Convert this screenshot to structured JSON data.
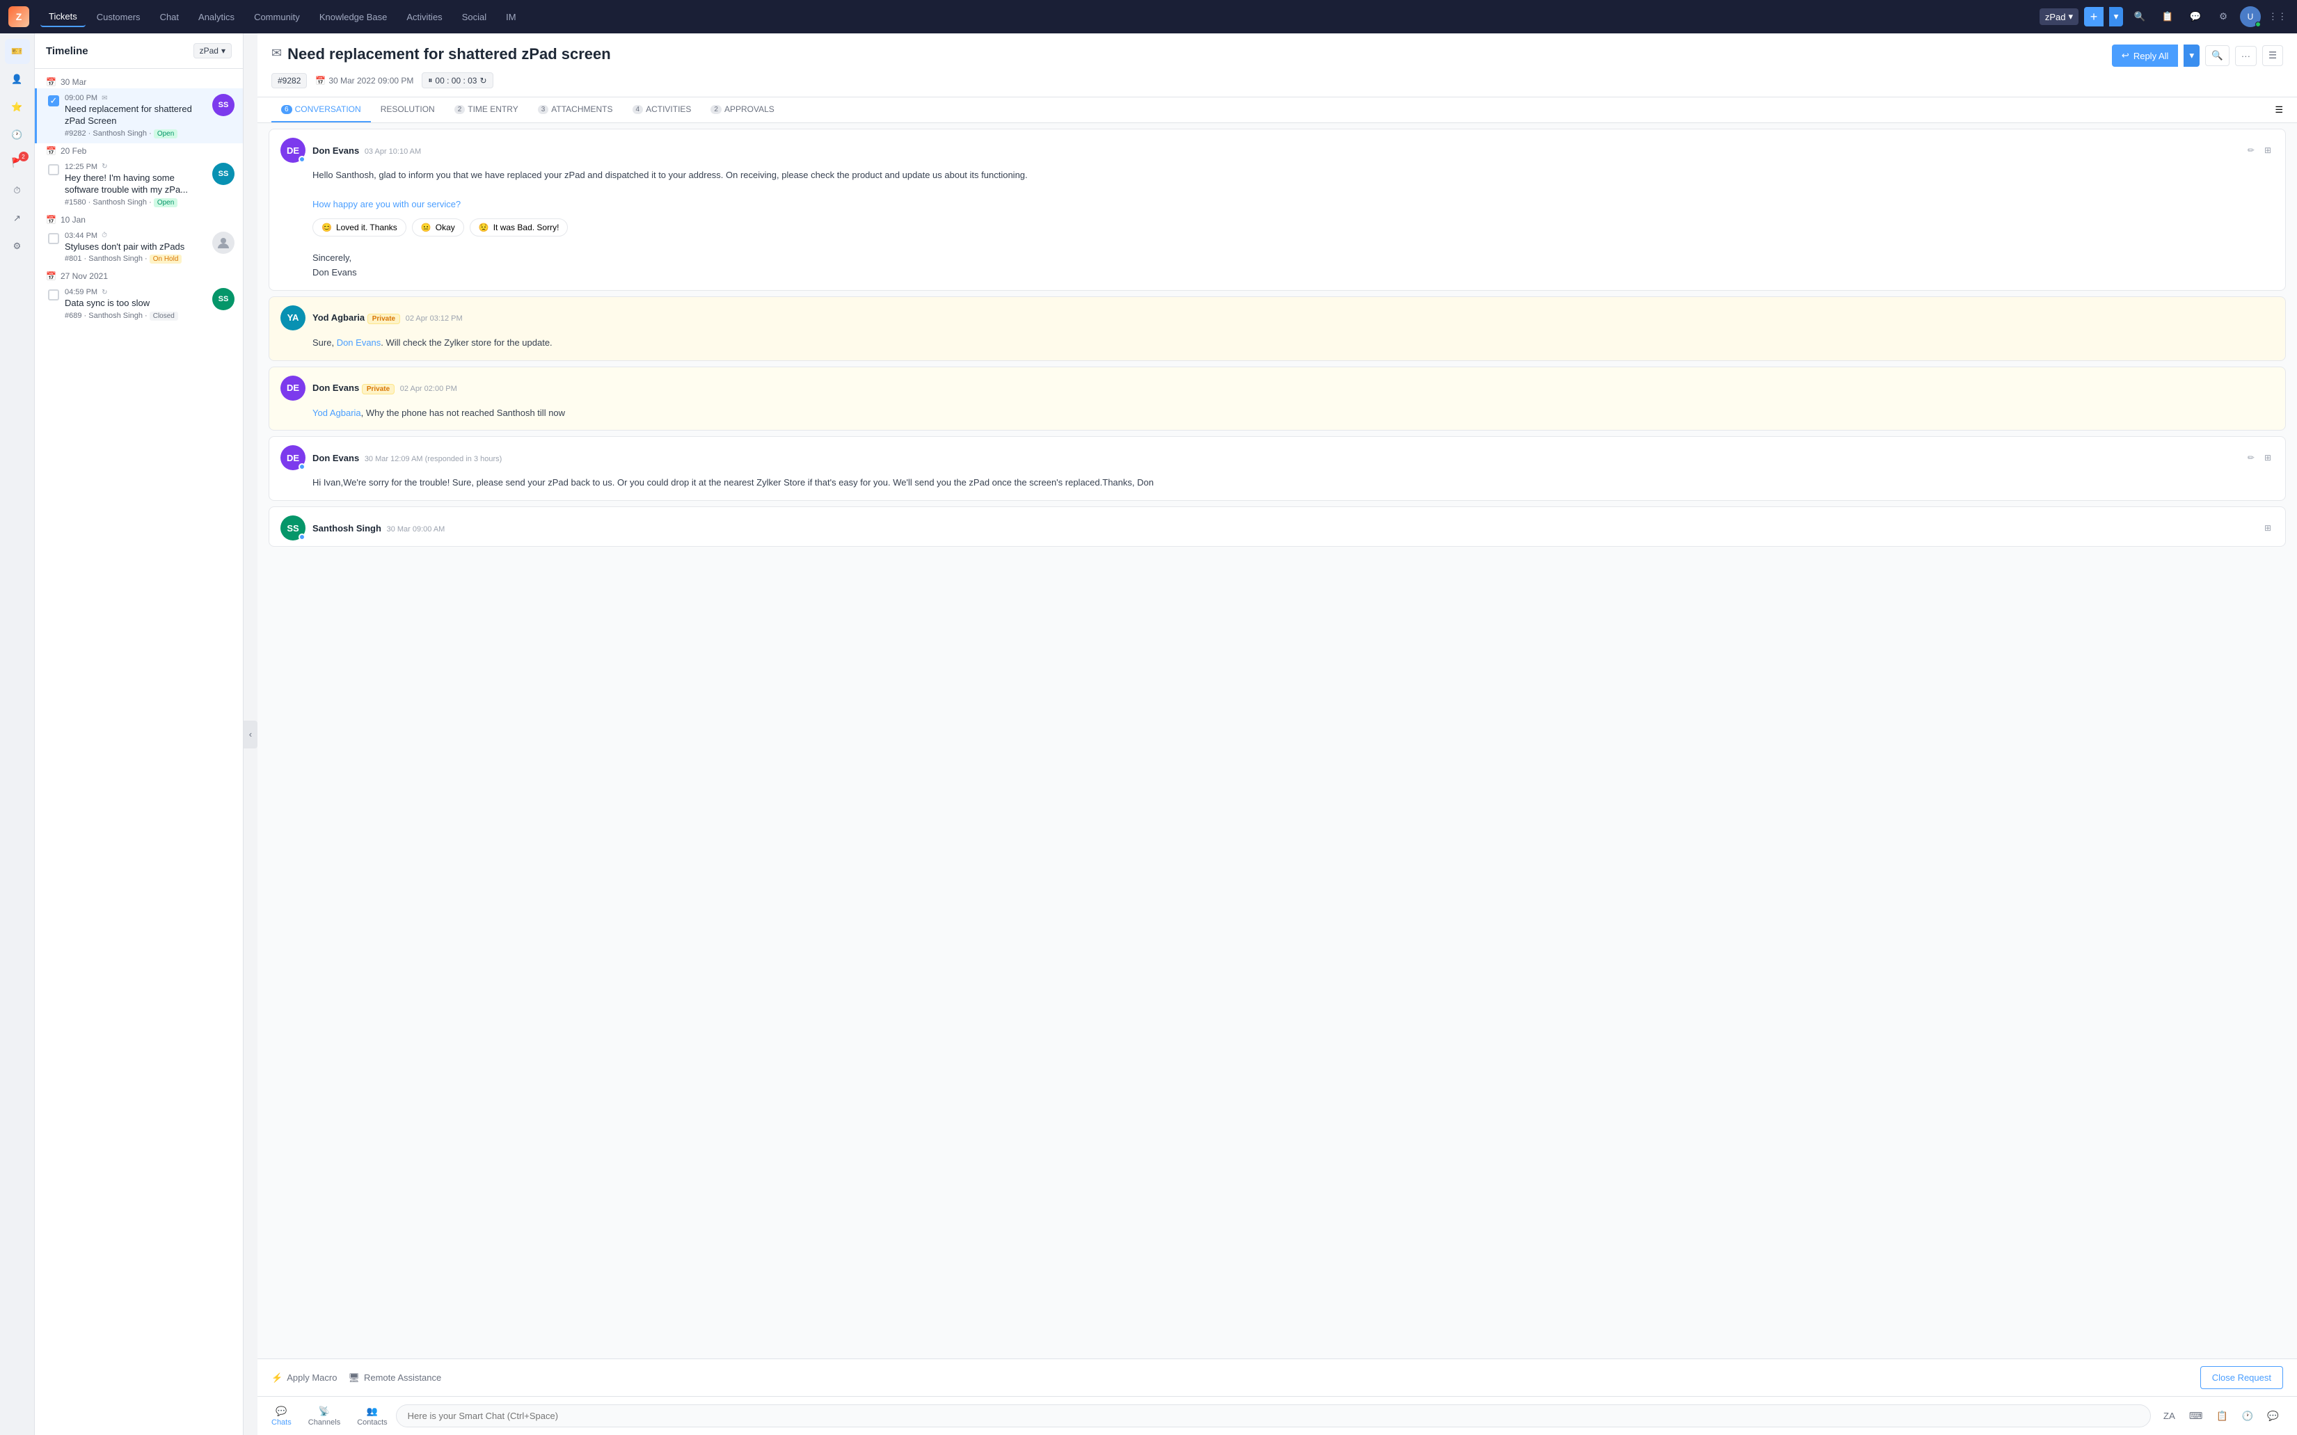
{
  "nav": {
    "logo_text": "Z",
    "items": [
      {
        "label": "Tickets",
        "active": true
      },
      {
        "label": "Customers"
      },
      {
        "label": "Chat"
      },
      {
        "label": "Analytics"
      },
      {
        "label": "Community"
      },
      {
        "label": "Knowledge Base"
      },
      {
        "label": "Activities"
      },
      {
        "label": "Social"
      },
      {
        "label": "IM"
      }
    ],
    "workspace": "zPad",
    "add_label": "+",
    "add_chevron": "▾"
  },
  "sidebar_icons": [
    {
      "name": "ticket-icon",
      "symbol": "🎫",
      "badge": null
    },
    {
      "name": "contact-icon",
      "symbol": "👤",
      "badge": null
    },
    {
      "name": "star-icon",
      "symbol": "⭐",
      "badge": null
    },
    {
      "name": "history-icon",
      "symbol": "🕐",
      "badge": null
    },
    {
      "name": "flag-icon",
      "symbol": "🚩",
      "badge": "2"
    },
    {
      "name": "clock-icon",
      "symbol": "⏱",
      "badge": null
    },
    {
      "name": "share-icon",
      "symbol": "↗",
      "badge": null
    },
    {
      "name": "settings-icon",
      "symbol": "⚙",
      "badge": null
    }
  ],
  "timeline": {
    "title": "Timeline",
    "filter_label": "zPad",
    "groups": [
      {
        "date": "30 Mar",
        "tickets": [
          {
            "time": "09:00 PM",
            "subject": "Need replacement for shattered zPad Screen",
            "id": "#9282",
            "agent": "Santhosh Singh",
            "status": "Open",
            "status_class": "status-open",
            "active": true,
            "checked": true
          }
        ]
      },
      {
        "date": "20 Feb",
        "tickets": [
          {
            "time": "12:25 PM",
            "subject": "Hey there! I'm having some software trouble with my zPa...",
            "id": "#1580",
            "agent": "Santhosh Singh",
            "status": "Open",
            "status_class": "status-open",
            "active": false,
            "checked": false
          }
        ]
      },
      {
        "date": "10 Jan",
        "tickets": [
          {
            "time": "03:44 PM",
            "subject": "Styluses don't pair with zPads",
            "id": "#801",
            "agent": "Santhosh Singh",
            "status": "On Hold",
            "status_class": "status-hold",
            "active": false,
            "checked": false
          }
        ]
      },
      {
        "date": "27 Nov 2021",
        "tickets": [
          {
            "time": "04:59 PM",
            "subject": "Data sync is too slow",
            "id": "#689",
            "agent": "Santhosh Singh",
            "status": "Closed",
            "status_class": "status-closed",
            "active": false,
            "checked": false
          }
        ]
      }
    ]
  },
  "ticket": {
    "title": "Need replacement for shattered zPad screen",
    "id": "#9282",
    "date": "30 Mar 2022 09:00 PM",
    "timer": "00 : 00 : 03",
    "reply_all_label": "Reply All",
    "tabs": [
      {
        "label": "CONVERSATION",
        "count": "6",
        "active": true,
        "count_class": "tab-count"
      },
      {
        "label": "RESOLUTION",
        "count": null,
        "active": false
      },
      {
        "label": "TIME ENTRY",
        "count": "2",
        "active": false,
        "count_class": "tab-count-gray"
      },
      {
        "label": "ATTACHMENTS",
        "count": "3",
        "active": false,
        "count_class": "tab-count-gray"
      },
      {
        "label": "ACTIVITIES",
        "count": "4",
        "active": false,
        "count_class": "tab-count-gray"
      },
      {
        "label": "APPROVALS",
        "count": "2",
        "active": false,
        "count_class": "tab-count-gray"
      }
    ]
  },
  "messages": [
    {
      "id": "msg1",
      "avatar_initials": "DE",
      "avatar_class": "av-don",
      "name": "Don Evans",
      "time": "03 Apr 10:10 AM",
      "type": "public",
      "body": "Hello Santhosh, glad to inform you that we have replaced your zPad and dispatched it to your address. On receiving, please check the product and update us about its functioning.",
      "feedback_question": "How happy are you with our service?",
      "feedback_options": [
        {
          "emoji": "😊",
          "label": "Loved it. Thanks"
        },
        {
          "emoji": "😐",
          "label": "Okay"
        },
        {
          "emoji": "😟",
          "label": "It was Bad. Sorry!"
        }
      ],
      "sign": "Sincerely,\nDon Evans",
      "status_dot": "blue"
    },
    {
      "id": "msg2",
      "avatar_initials": "YA",
      "avatar_class": "av-yod",
      "name": "Yod Agbaria",
      "badge": "Private",
      "time": "02 Apr 03:12 PM",
      "type": "private",
      "body": "Sure, Don Evans. Will check the Zylker store for the update.",
      "link_text": "Don Evans",
      "status_dot": null
    },
    {
      "id": "msg3",
      "avatar_initials": "DE",
      "avatar_class": "av-don",
      "name": "Don Evans",
      "badge": "Private",
      "time": "02 Apr 02:00 PM",
      "type": "private-blue",
      "body": "Yod Agbaria,  Why the phone has not reached Santhosh till now",
      "link_text": "Yod Agbaria",
      "status_dot": null
    },
    {
      "id": "msg4",
      "avatar_initials": "DE",
      "avatar_class": "av-don",
      "name": "Don Evans",
      "time": "30 Mar 12:09 AM (responded in 3 hours)",
      "type": "public",
      "body": "Hi Ivan,We're sorry for the trouble! Sure, please send your zPad back to us. Or you could drop it at the nearest Zylker Store if that's easy for you. We'll send you the zPad once the screen's replaced.Thanks, Don",
      "status_dot": "blue"
    },
    {
      "id": "msg5",
      "avatar_initials": "SS",
      "avatar_class": "av-santhosh",
      "name": "Santhosh Singh",
      "time": "30 Mar 09:00 AM",
      "type": "public",
      "body": "...",
      "status_dot": "blue"
    }
  ],
  "bottom_bar": {
    "apply_macro_label": "Apply Macro",
    "remote_assistance_label": "Remote Assistance",
    "close_request_label": "Close Request"
  },
  "bottom_nav": {
    "items": [
      {
        "label": "Chats",
        "active": true
      },
      {
        "label": "Channels"
      },
      {
        "label": "Contacts"
      }
    ],
    "chat_placeholder": "Here is your Smart Chat (Ctrl+Space)",
    "tools": [
      "ZA",
      "⌨",
      "📋",
      "🕐",
      "💬"
    ]
  }
}
